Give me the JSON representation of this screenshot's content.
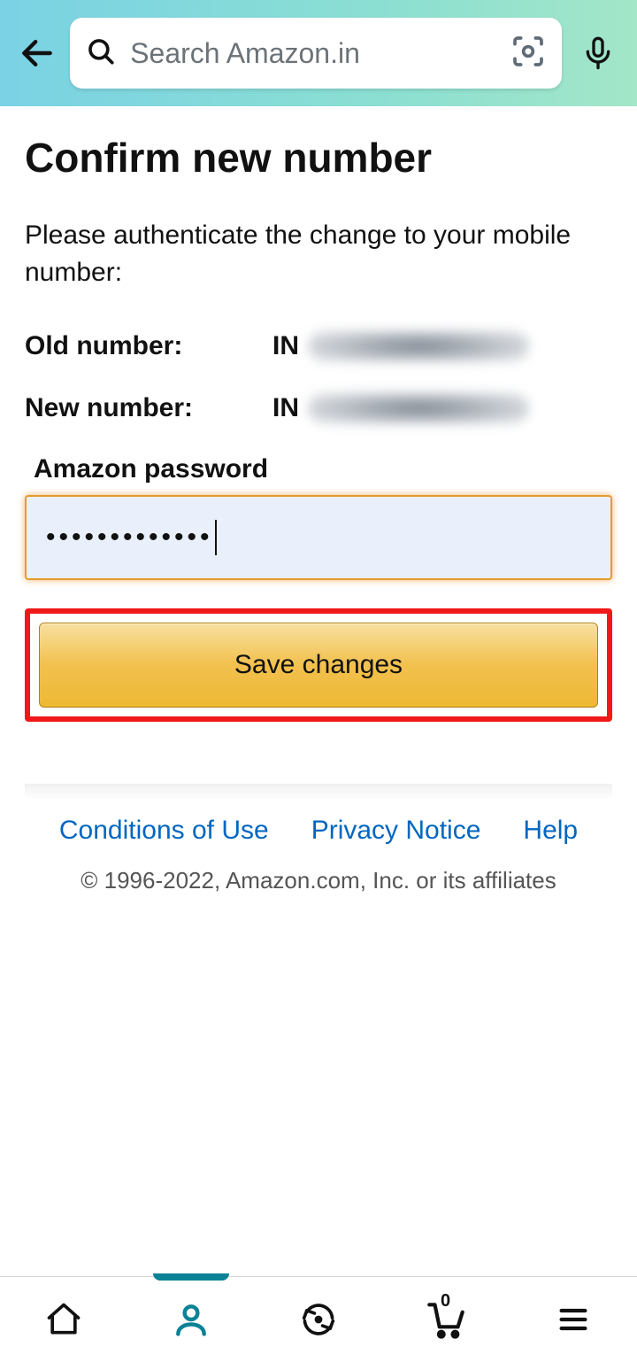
{
  "header": {
    "search_placeholder": "Search Amazon.in"
  },
  "page": {
    "title": "Confirm new number",
    "instruction": "Please authenticate the change to your mobile number:",
    "old_label": "Old number:",
    "old_prefix": "IN",
    "new_label": "New number:",
    "new_prefix": "IN",
    "password_label": "Amazon password",
    "password_value": "•••••••••••••",
    "save_label": "Save changes"
  },
  "footer": {
    "links": {
      "conditions": "Conditions of Use",
      "privacy": "Privacy Notice",
      "help": "Help"
    },
    "copyright": "© 1996-2022, Amazon.com, Inc. or its affiliates"
  },
  "nav": {
    "cart_count": "0"
  }
}
